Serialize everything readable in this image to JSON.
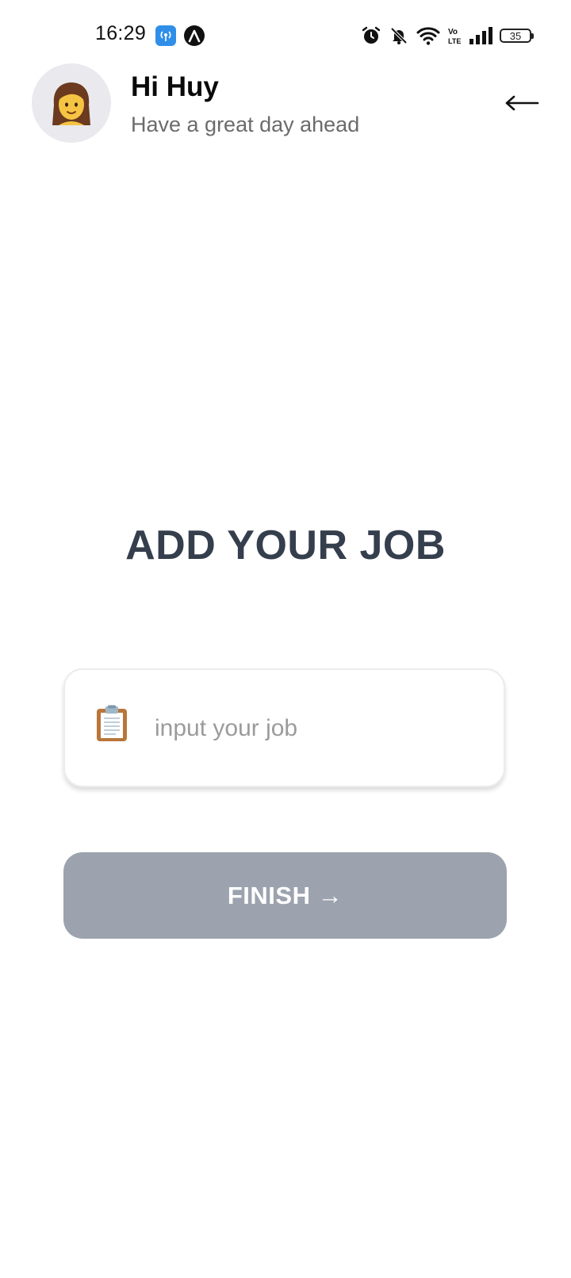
{
  "status_bar": {
    "time": "16:29",
    "battery_level": "35",
    "icons": [
      "hotspot-app-icon",
      "arc-app-icon",
      "alarm-icon",
      "bell-muted-icon",
      "wifi-icon",
      "volte-icon",
      "signal-icon",
      "battery-icon"
    ]
  },
  "header": {
    "greeting": "Hi Huy",
    "subtitle": "Have a great day ahead",
    "avatar_icon": "woman-emoji-icon",
    "back_icon": "arrow-left-icon"
  },
  "main": {
    "title": "ADD YOUR JOB",
    "job_input": {
      "icon": "clipboard-icon",
      "value": "",
      "placeholder": "input your job"
    },
    "finish_button": {
      "label": "FINISH →",
      "disabled_color": "#9ca3ae"
    }
  },
  "colors": {
    "title": "#353e4d",
    "subtitle": "#6b6b6b",
    "placeholder": "#9b9b9b",
    "avatar_bg": "#e9e9ee"
  }
}
